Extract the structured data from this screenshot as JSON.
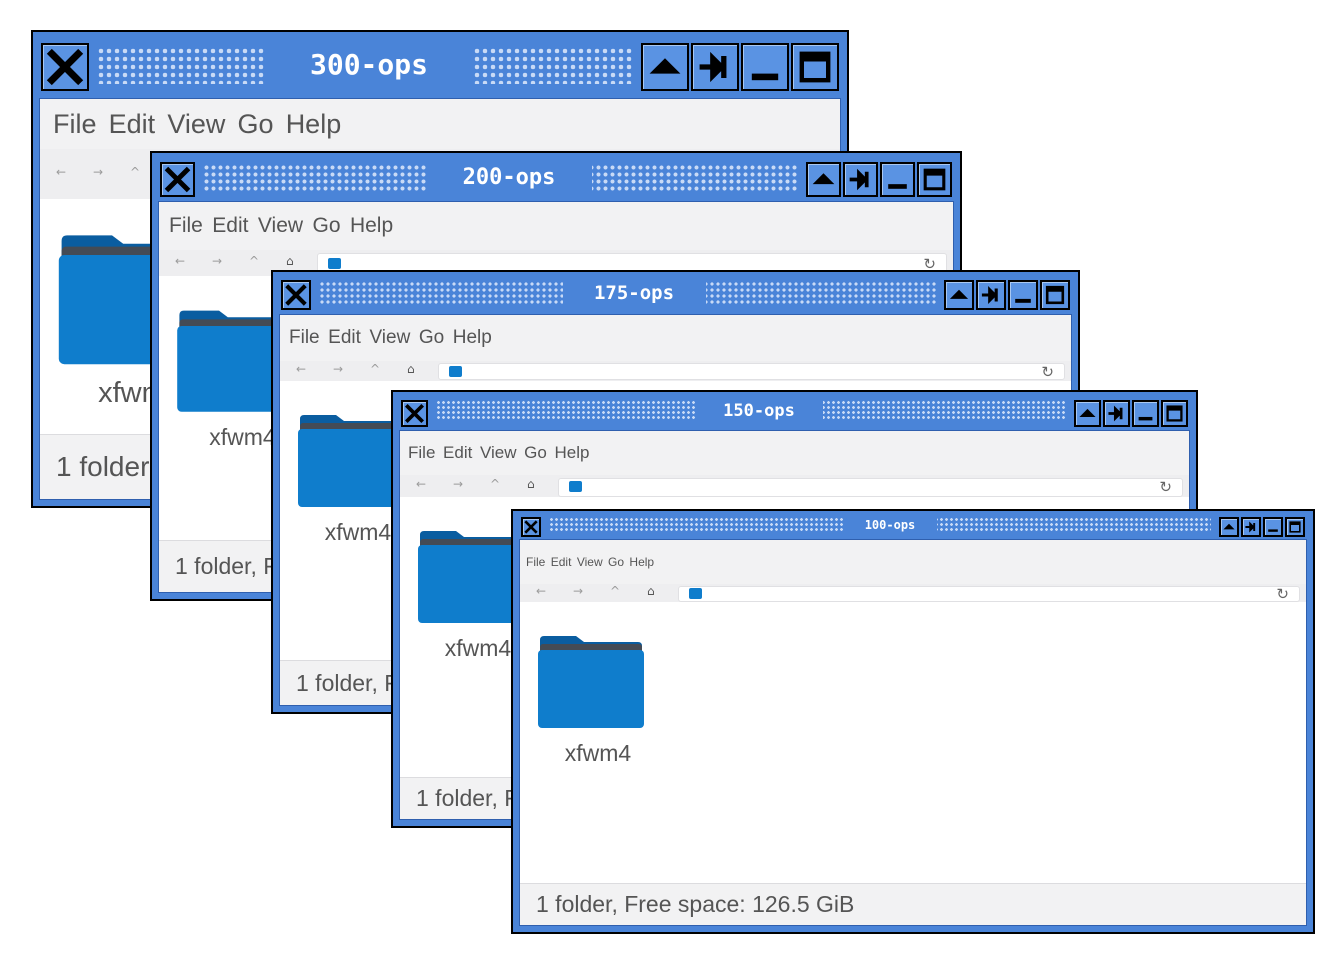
{
  "icons": {
    "close": "close-icon",
    "shade": "shade-up-icon",
    "stick": "pin-icon",
    "minimize": "minimize-icon",
    "maximize": "maximize-icon",
    "back": "arrow-left-icon",
    "forward": "arrow-right-icon",
    "up": "arrow-up-icon",
    "home": "home-icon",
    "reload": "reload-icon",
    "folder": "folder-icon"
  },
  "colors": {
    "titlebar": "#4a84d8",
    "folder": "#0f7dcc",
    "folder_tab": "#0a5da0"
  },
  "menu": {
    "file": "File",
    "edit": "Edit",
    "view": "View",
    "go": "Go",
    "help": "Help"
  },
  "nav_glyphs": {
    "back": "←",
    "forward": "→",
    "up": "^",
    "home": "⌂",
    "reload": "↻"
  },
  "windows": [
    {
      "title": "300-ops",
      "folder_name": "xfwm4",
      "status": "1 folder, Free space: 126.5 GiB"
    },
    {
      "title": "200-ops",
      "folder_name": "xfwm4",
      "status": "1 folder, Free space: 126.5 GiB"
    },
    {
      "title": "175-ops",
      "folder_name": "xfwm4",
      "status": "1 folder, Free space: 126.5 GiB"
    },
    {
      "title": "150-ops",
      "folder_name": "xfwm4",
      "status": "1 folder, Free space: 126.5 GiB"
    },
    {
      "title": "100-ops",
      "folder_name": "xfwm4",
      "status": "1 folder, Free space: 126.5 GiB"
    }
  ]
}
